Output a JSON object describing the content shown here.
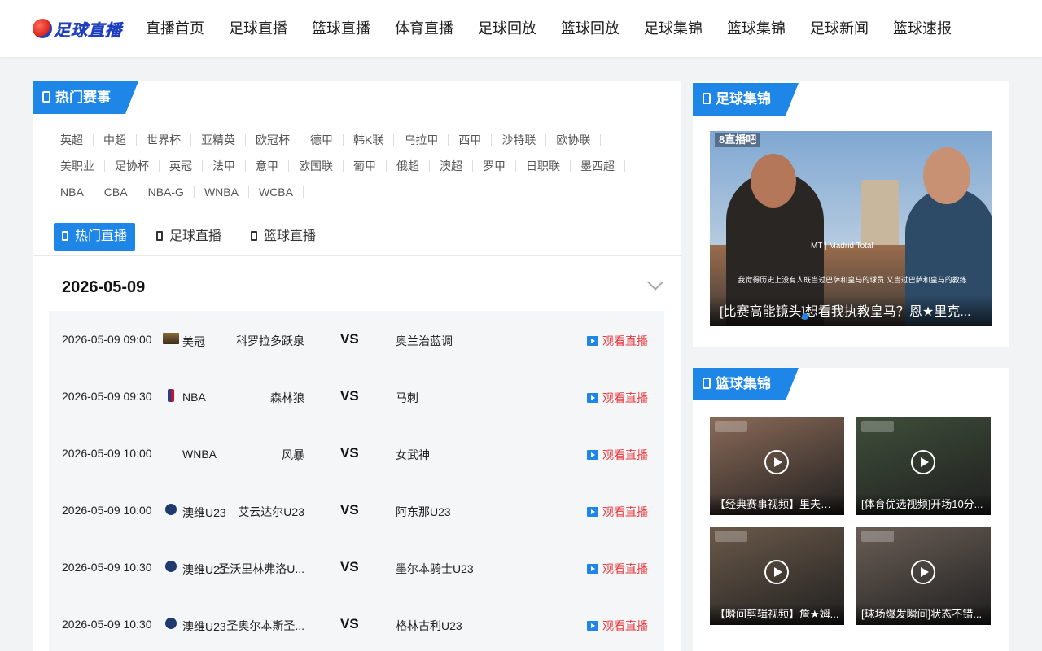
{
  "header": {
    "logo_text": "足球直播",
    "nav": [
      "直播首页",
      "足球直播",
      "篮球直播",
      "体育直播",
      "足球回放",
      "篮球回放",
      "足球集锦",
      "篮球集锦",
      "足球新闻",
      "篮球速报"
    ]
  },
  "hot": {
    "title": "热门赛事",
    "tag_rows": [
      [
        "英超",
        "中超",
        "世界杯",
        "亚精英",
        "欧冠杯",
        "德甲",
        "韩K联",
        "乌拉甲",
        "西甲",
        "沙特联",
        "欧协联"
      ],
      [
        "美职业",
        "足协杯",
        "英冠",
        "法甲",
        "意甲",
        "欧国联",
        "葡甲",
        "俄超",
        "澳超",
        "罗甲",
        "日职联",
        "墨西超"
      ],
      [
        "NBA",
        "CBA",
        "NBA-G",
        "WNBA",
        "WCBA"
      ]
    ]
  },
  "tabs": [
    {
      "label": "热门直播",
      "active": true
    },
    {
      "label": "足球直播",
      "active": false
    },
    {
      "label": "篮球直播",
      "active": false
    }
  ],
  "schedule": {
    "date": "2026-05-09",
    "vs_label": "VS",
    "watch_label": "观看直播",
    "matches": [
      {
        "time": "2026-05-09 09:00",
        "league": "美冠",
        "icon": "shield",
        "home": "科罗拉多跃泉",
        "away": "奥兰治蓝调"
      },
      {
        "time": "2026-05-09 09:30",
        "league": "NBA",
        "icon": "nba",
        "home": "森林狼",
        "away": "马刺"
      },
      {
        "time": "2026-05-09 10:00",
        "league": "WNBA",
        "icon": "wnba",
        "home": "风暴",
        "away": "女武神"
      },
      {
        "time": "2026-05-09 10:00",
        "league": "澳维U23",
        "icon": "au",
        "home": "艾云达尔U23",
        "away": "阿东那U23"
      },
      {
        "time": "2026-05-09 10:30",
        "league": "澳维U23",
        "icon": "au",
        "home": "圣沃里林弗洛U...",
        "away": "墨尔本骑士U23"
      },
      {
        "time": "2026-05-09 10:30",
        "league": "澳维U23",
        "icon": "au",
        "home": "圣奥尔本斯圣...",
        "away": "格林古利U23"
      }
    ]
  },
  "football_highlights": {
    "title": "足球集锦",
    "feature": {
      "brand": "8直播吧",
      "watermark": "MT | Madrid Total",
      "subtitle": "我觉得历史上没有人既当过巴萨和皇马的球员 又当过巴萨和皇马的教练",
      "caption": "[比赛高能镜头]想看我执教皇马？恩★里克..."
    }
  },
  "basketball_highlights": {
    "title": "篮球集锦",
    "items": [
      {
        "caption": "【经典赛事视频】里夫斯...",
        "color": "#8a6a58"
      },
      {
        "caption": "[体育优选视频]开场10分...",
        "color": "#3f4e3a"
      },
      {
        "caption": "【瞬间剪辑视频】詹★姆...",
        "color": "#6b5a4a"
      },
      {
        "caption": "[球场爆发瞬间]状态不错...",
        "color": "#6a5e56"
      }
    ]
  }
}
